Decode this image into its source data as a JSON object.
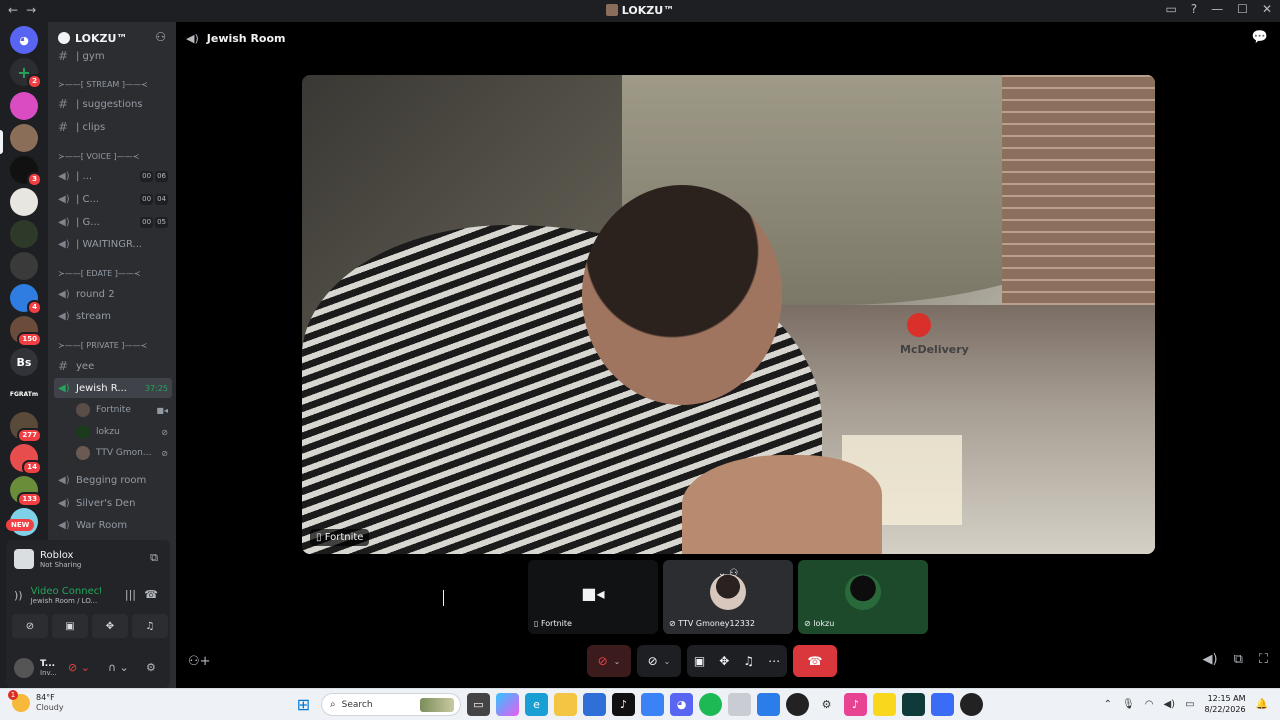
{
  "window": {
    "title": "LOKZU™",
    "back": "←",
    "forward": "→"
  },
  "colors": {
    "accent": "#5865f2",
    "green": "#23a55a",
    "danger": "#da373c"
  },
  "rail": {
    "badges": [
      "2",
      "3",
      "4",
      "150",
      "277",
      "14",
      "133"
    ],
    "bs_label": "Bs",
    "fgrat_label": "FGRATm",
    "new_label": "NEW"
  },
  "server": {
    "name": "LOKZU™"
  },
  "channels": {
    "gym": "| gym",
    "cat_stream": "≻——[ STREAM ]——≺",
    "suggestions": "| suggestions",
    "clips": "| clips",
    "cat_voice": "≻——[ VOICE ]——≺",
    "v1": {
      "name": "| ...",
      "a": "00",
      "b": "06"
    },
    "v2": {
      "name": "| C...",
      "a": "00",
      "b": "04"
    },
    "v3": {
      "name": "| G...",
      "a": "00",
      "b": "05"
    },
    "v4": {
      "name": "| WAITINGR..."
    },
    "cat_edate": "≻——[ EDATE ]——≺",
    "round2": "round 2",
    "stream": "stream",
    "cat_private": "≻——[ PRIVATE ]——≺",
    "yee": "yee",
    "jewish": {
      "name": "Jewish R...",
      "timer": "37:25"
    },
    "members": [
      "Fortnite",
      "lokzu",
      "TTV Gmon..."
    ],
    "begging": "Begging room",
    "silvers": "Silver's Den",
    "war": "War Room"
  },
  "activity": {
    "title": "Roblox",
    "status": "Not Sharing"
  },
  "voice": {
    "status": "Video Connected",
    "location": "Jewish Room / LO..."
  },
  "user": {
    "name": "T...",
    "status": "Inv..."
  },
  "stage": {
    "channel": "Jewish Room",
    "main_label": "Fortnite",
    "sign_text": "McDelivery",
    "tiles": [
      "Fortnite",
      "TTV Gmoney12332",
      "lokzu"
    ]
  },
  "taskbar": {
    "temp": "84°F",
    "weather": "Cloudy",
    "weather_badge": "1",
    "search_placeholder": "Search",
    "time": "12:15 AM",
    "date": "8/22/2026"
  }
}
